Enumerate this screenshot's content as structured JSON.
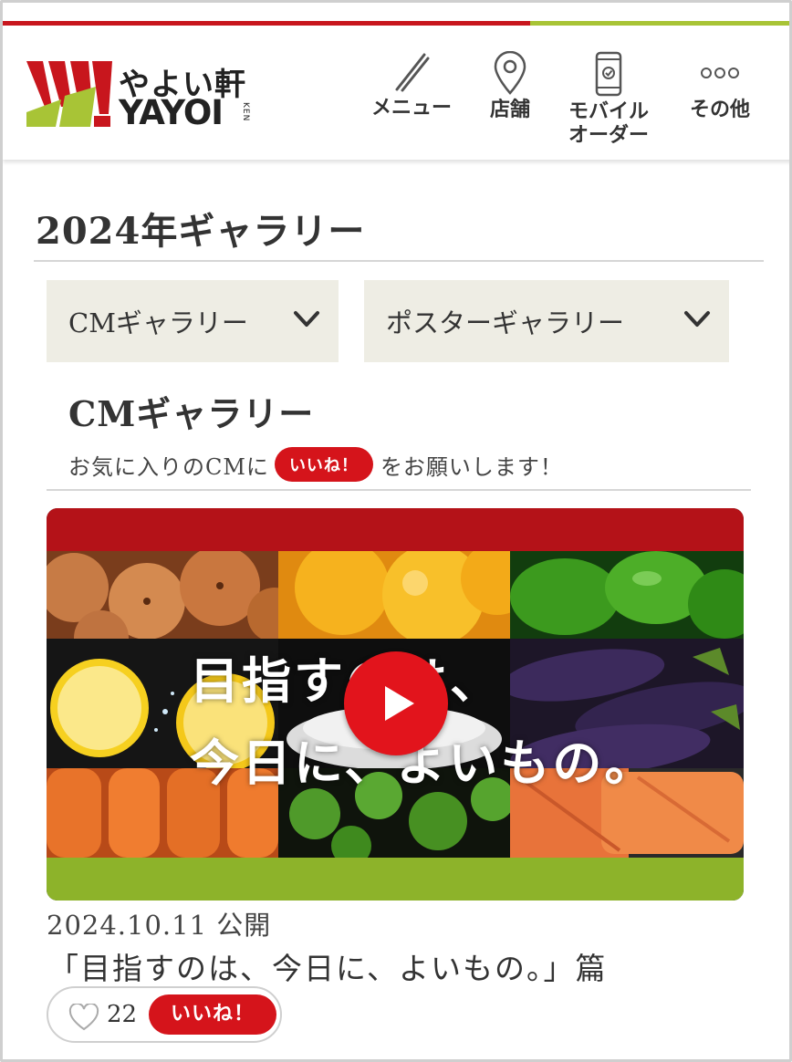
{
  "brand": {
    "name_jp": "やよい軒",
    "name_en": "YAYOI",
    "name_ken": "KEN",
    "colors": {
      "red": "#c8161d",
      "green": "#a8c436",
      "dropdown_bg": "#eeede4",
      "like_red": "#d5141b"
    }
  },
  "nav": {
    "menu": {
      "label": "メニュー",
      "icon": "chopsticks-icon"
    },
    "store": {
      "label": "店舗",
      "icon": "location-pin-icon"
    },
    "mobile_order": {
      "label_line1": "モバイル",
      "label_line2": "オーダー",
      "icon": "smartphone-icon"
    },
    "other": {
      "label": "その他",
      "icon": "more-dots-icon"
    }
  },
  "page": {
    "title": "2024年ギャラリー"
  },
  "dropdowns": {
    "cm": {
      "label": "CMギャラリー",
      "icon": "chevron-down-icon"
    },
    "poster": {
      "label": "ポスターギャラリー",
      "icon": "chevron-down-icon"
    }
  },
  "section": {
    "title": "CMギャラリー",
    "desc_before": "お気に入りのCMに",
    "desc_pill": "いいね！",
    "desc_after": "をお願いします！"
  },
  "video": {
    "overlay_line1": "目指すのは、",
    "overlay_line2": "今日に、よいもの。",
    "play_icon": "play-icon",
    "date": "2024.10.11 公開",
    "title": "「目指すのは、今日に、よいもの。」篇",
    "like_count": "22",
    "like_button": "いいね！",
    "like_icon": "heart-outline-icon"
  }
}
